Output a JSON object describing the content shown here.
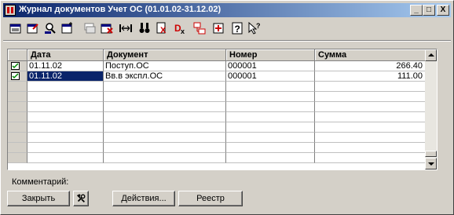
{
  "window": {
    "title": "Журнал документов  Учет ОС (01.01.02-31.12.02)",
    "controls": {
      "minimize": "_",
      "maximize": "□",
      "close": "X"
    }
  },
  "toolbar": {
    "icons": [
      "new-doc-icon",
      "copy-doc-icon",
      "find-icon",
      "new-line-icon",
      "print-icon",
      "delete-icon",
      "interval-icon",
      "filter-icon",
      "post-icon",
      "unpost-icon",
      "subordinate-icon",
      "move-icon",
      "help-icon",
      "context-help-icon"
    ]
  },
  "table": {
    "columns": [
      "Дата",
      "Документ",
      "Номер",
      "Сумма"
    ],
    "rows": [
      {
        "date": "01.11.02",
        "document": "Поступ.ОС",
        "number": "000001",
        "sum": "266.40"
      },
      {
        "date": "01.11.02",
        "document": "Вв.в экспл.ОС",
        "number": "000001",
        "sum": "111.00"
      }
    ]
  },
  "comment_label": "Комментарий:",
  "buttons": {
    "close": "Закрыть",
    "actions": "Действия...",
    "registry": "Реестр"
  }
}
